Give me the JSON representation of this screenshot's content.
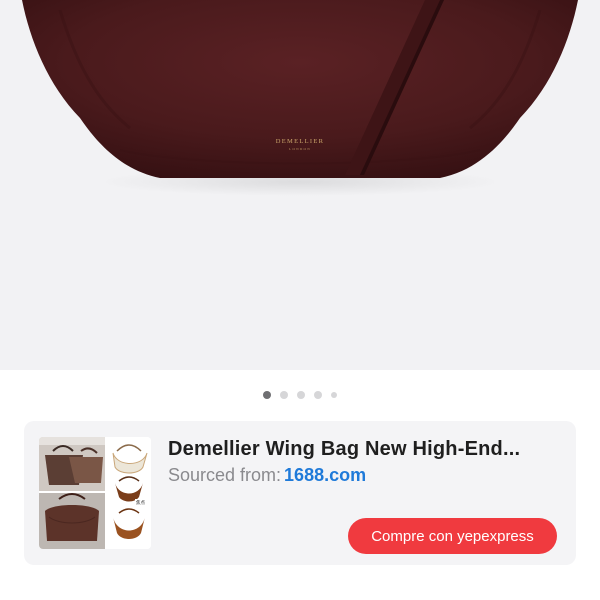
{
  "product_image": {
    "brand_mark": "DEMELLIER",
    "brand_sub": "LONDON",
    "image_icon": "suede-bag-photo"
  },
  "carousel": {
    "count": 5,
    "active_index": 0
  },
  "product_card": {
    "title": "Demellier Wing Bag New High-End...",
    "sourced_label": "Sourced from:",
    "source_site": "1688.com",
    "thumbnail_icon": "product-collage-thumbnail",
    "buy_button_label": "Compre con yepexpress"
  },
  "colors": {
    "bag": "#4a1a1c",
    "button": "#f03a3f",
    "link": "#1f7ad9"
  }
}
